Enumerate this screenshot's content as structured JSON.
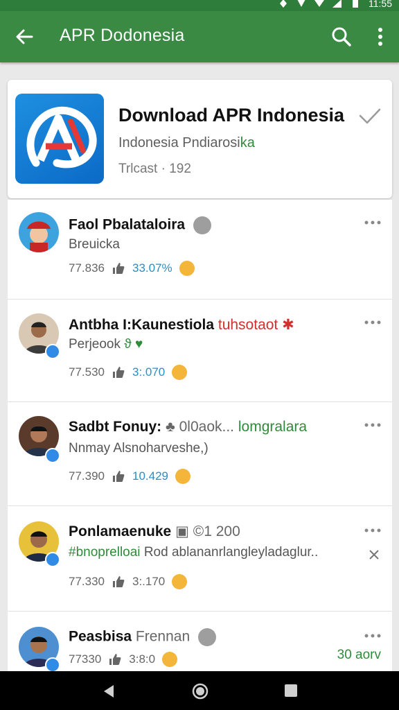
{
  "status_bar": {
    "time": "11:55"
  },
  "app_bar": {
    "title": "APR Dodonesia"
  },
  "app_card": {
    "title": "Download APR Indonesia",
    "subtitle_prefix": "Indonesia Pndiarosi",
    "subtitle_highlight": "ka",
    "meta_label": "Trlcast",
    "meta_sep": "·",
    "meta_count": "192"
  },
  "posts": [
    {
      "name": "Faol Pbalataloira",
      "subtitle": "Breuicka",
      "count": "77.836",
      "likes": "33.07%",
      "likes_color": "blue"
    },
    {
      "name": "Antbha I:Kaunestiola",
      "name_extra": "tuhsotaot",
      "subtitle": "Perjeook",
      "subtitle_extra": "ϑ",
      "count": "77.530",
      "likes": "3:.070"
    },
    {
      "name": "Sadbt Fonuy:",
      "name_extra": "0l0aok...",
      "name_extra2": "lomgralara",
      "subtitle": "Nnmay Alsnoharveshe,)",
      "count": "77.390",
      "likes": "10.429"
    },
    {
      "name": "Ponlamaenuke",
      "name_extra": "©1 200",
      "subtitle": "#bnoprelloai",
      "subtitle_extra": "Rod ablananrlangleyladaglur..",
      "count": "77.330",
      "likes": "3:.170"
    },
    {
      "name": "Peasbisa",
      "name_extra": "Frennan",
      "count": "77330",
      "likes": "3:8:0",
      "right_text": "30 aorv"
    }
  ],
  "icons": {
    "back": "arrow-left-icon",
    "search": "search-icon",
    "more": "more-vert-icon",
    "check": "check-icon",
    "like": "thumb-up-icon",
    "emoji": "smiley-icon"
  },
  "colors": {
    "appbar": "#3a8a44",
    "accent_green": "#2e8b3a",
    "link_blue": "#2a8fc4",
    "verified_blue": "#2f8be6"
  }
}
